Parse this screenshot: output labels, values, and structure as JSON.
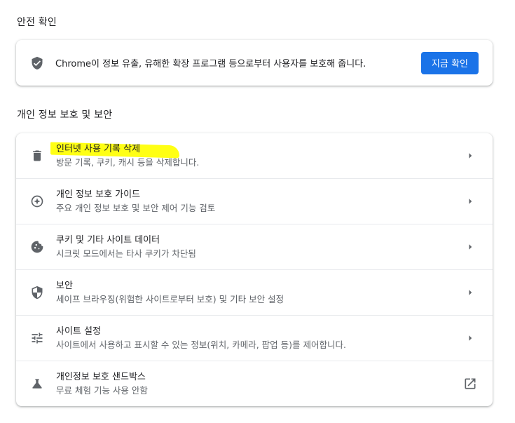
{
  "safety_check": {
    "title": "안전 확인",
    "description": "Chrome이 정보 유출, 유해한 확장 프로그램 등으로부터 사용자를 보호해 줍니다.",
    "button_label": "지금 확인",
    "icon": "shield-check-icon"
  },
  "privacy": {
    "title": "개인 정보 보호 및 보안",
    "highlight_color": "#ffff00",
    "items": [
      {
        "label": "인터넷 사용 기록 삭제",
        "sub": "방문 기록, 쿠키, 캐시 등을 삭제합니다.",
        "icon": "trash-icon",
        "action": "chevron-right-icon"
      },
      {
        "label": "개인 정보 보호 가이드",
        "sub": "주요 개인 정보 보호 및 보안 제어 기능 검토",
        "icon": "compass-icon",
        "action": "chevron-right-icon"
      },
      {
        "label": "쿠키 및 기타 사이트 데이터",
        "sub": "시크릿 모드에서는 타사 쿠키가 차단됨",
        "icon": "cookie-icon",
        "action": "chevron-right-icon"
      },
      {
        "label": "보안",
        "sub": "세이프 브라우징(위험한 사이트로부터 보호) 및 기타 보안 설정",
        "icon": "security-shield-icon",
        "action": "chevron-right-icon"
      },
      {
        "label": "사이트 설정",
        "sub": "사이트에서 사용하고 표시할 수 있는 정보(위치, 카메라, 팝업 등)를 제어합니다.",
        "icon": "tune-icon",
        "action": "chevron-right-icon"
      },
      {
        "label": "개인정보 보호 샌드박스",
        "sub": "무료 체험 기능 사용 안함",
        "icon": "flask-icon",
        "action": "open-in-new-icon"
      }
    ]
  },
  "colors": {
    "primary": "#1a73e8",
    "text": "#202124",
    "secondary_text": "#5f6368"
  }
}
